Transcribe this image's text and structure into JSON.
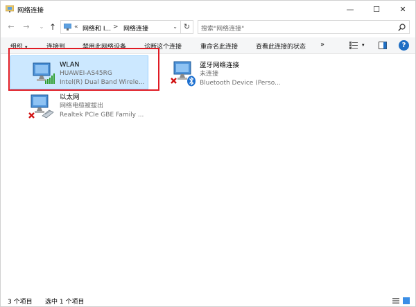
{
  "window": {
    "title": "网络连接",
    "minimize_glyph": "—",
    "maximize_glyph": "☐",
    "close_glyph": "✕"
  },
  "nav": {
    "back_glyph": "←",
    "forward_glyph": "→",
    "recent_glyph": "⌄",
    "up_glyph": "↑",
    "address_chevron": "«",
    "address_segment_1": "网络和 I...",
    "address_separator": ">",
    "address_segment_2": "网络连接",
    "address_dropdown": "⌄",
    "refresh_glyph": "↻",
    "search_placeholder": "搜索\"网络连接\""
  },
  "toolbar": {
    "organize": "组织",
    "organize_caret": "▾",
    "connect_to": "连接到",
    "disable": "禁用此网络设备",
    "diagnose": "诊断这个连接",
    "rename": "重命名此连接",
    "view_status": "查看此连接的状态",
    "more": "»",
    "view_caret": "▾",
    "help": "?"
  },
  "items": [
    {
      "name": "WLAN",
      "line2": "HUAWEI-AS45RG",
      "line3": "Intel(R) Dual Band Wirele...",
      "icon": "wifi-adapter-icon",
      "selected": true
    },
    {
      "name": "蓝牙网络连接",
      "line2": "未连接",
      "line3": "Bluetooth Device (Perso...",
      "icon": "bluetooth-adapter-icon",
      "selected": false
    },
    {
      "name": "以太网",
      "line2": "网络电缆被拔出",
      "line3": "Realtek PCIe GBE Family ...",
      "icon": "ethernet-adapter-icon",
      "selected": false
    }
  ],
  "status": {
    "count": "3 个项目",
    "selected": "选中 1 个项目"
  },
  "colors": {
    "selection_bg": "#cce8ff",
    "selection_border": "#99d1ff",
    "highlight_annotation": "#e01b24",
    "accent": "#1f6fc4"
  }
}
